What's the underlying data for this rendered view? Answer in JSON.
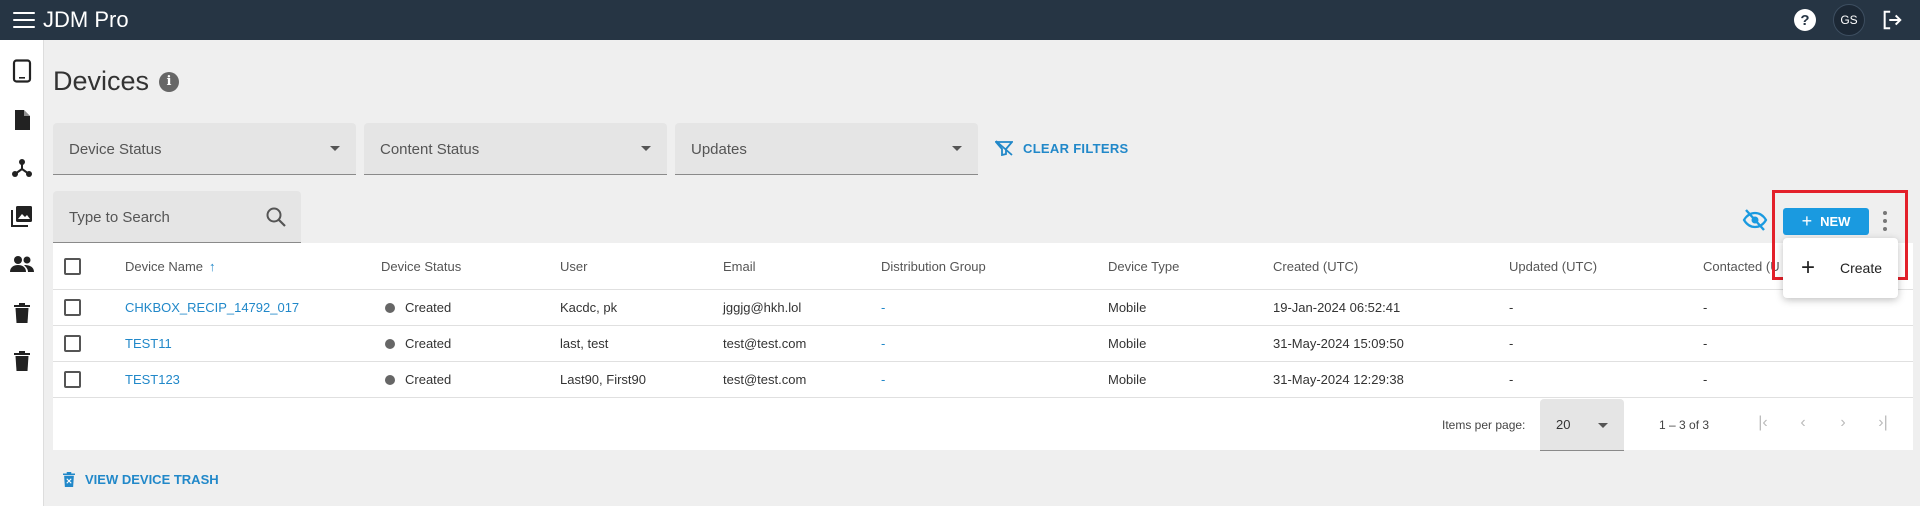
{
  "app": {
    "title": "JDM Pro",
    "user_initials": "GS"
  },
  "page": {
    "title": "Devices"
  },
  "filters": [
    {
      "label": "Device Status"
    },
    {
      "label": "Content Status"
    },
    {
      "label": "Updates"
    }
  ],
  "clear_filters_label": "CLEAR FILTERS",
  "search": {
    "placeholder": "Type to Search"
  },
  "new_button_label": "NEW",
  "menu": {
    "create_label": "Create"
  },
  "table": {
    "columns": [
      "Device Name",
      "Device Status",
      "User",
      "Email",
      "Distribution Group",
      "Device Type",
      "Created (UTC)",
      "Updated (UTC)",
      "Contacted (U"
    ],
    "rows": [
      {
        "name": "CHKBOX_RECIP_14792_017",
        "status": "Created",
        "user": "Kacdc, pk",
        "email": "jggjg@hkh.lol",
        "group": "-",
        "type": "Mobile",
        "created": "19-Jan-2024 06:52:41",
        "updated": "-",
        "contacted": "-"
      },
      {
        "name": "TEST11",
        "status": "Created",
        "user": "last, test",
        "email": "test@test.com",
        "group": "-",
        "type": "Mobile",
        "created": "31-May-2024 15:09:50",
        "updated": "-",
        "contacted": "-"
      },
      {
        "name": "TEST123",
        "status": "Created",
        "user": "Last90, First90",
        "email": "test@test.com",
        "group": "-",
        "type": "Mobile",
        "created": "31-May-2024 12:29:38",
        "updated": "-",
        "contacted": "-"
      }
    ]
  },
  "paginator": {
    "items_per_page_label": "Items per page:",
    "page_size": "20",
    "range": "1 – 3 of 3"
  },
  "trash_link_label": "VIEW DEVICE TRASH",
  "colors": {
    "topbar": "#263544",
    "accent": "#1a9ae0",
    "link": "#2188c9",
    "highlight": "#e3202a"
  }
}
